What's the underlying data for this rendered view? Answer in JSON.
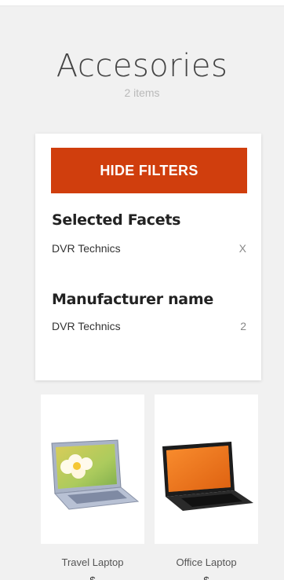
{
  "category": {
    "title": "Accesories",
    "count_label": "2 items"
  },
  "filters": {
    "hide_button_label": "HIDE FILTERS",
    "selected_title": "Selected Facets",
    "selected": [
      {
        "label": "DVR Technics",
        "remove_label": "X"
      }
    ],
    "manufacturer_title": "Manufacturer name",
    "manufacturers": [
      {
        "label": "DVR Technics",
        "count": "2"
      }
    ]
  },
  "products": [
    {
      "name": "Travel Laptop",
      "price": "$"
    },
    {
      "name": "Office Laptop",
      "price": "$"
    }
  ],
  "colors": {
    "accent": "#d03e0d",
    "background": "#f1f1f1",
    "card": "#ffffff"
  }
}
